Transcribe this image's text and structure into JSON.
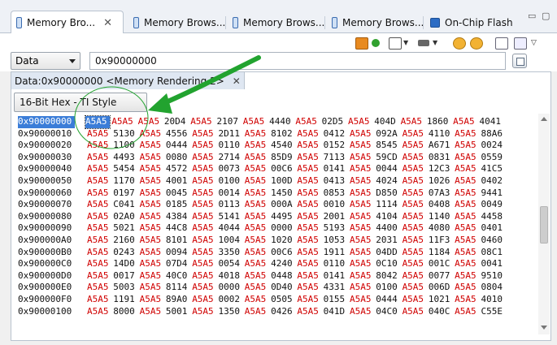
{
  "tabs": [
    {
      "label": "Memory Bro...",
      "active": true
    },
    {
      "label": "Memory Brows...",
      "active": false
    },
    {
      "label": "Memory Brows...",
      "active": false
    },
    {
      "label": "Memory Brows...",
      "active": false
    },
    {
      "label": "On-Chip Flash",
      "active": false
    }
  ],
  "window_controls": {
    "minimize": "▭",
    "maximize": "▢"
  },
  "toolbar_icons": [
    "refresh-icon",
    "import-icon",
    "chip-icon",
    "go-icon",
    "sync-icon",
    "new-view-icon",
    "pin-icon",
    "view-menu-icon"
  ],
  "format_select": {
    "value": "Data"
  },
  "address_input": {
    "value": "0x90000000"
  },
  "rendering_tab": {
    "label": "Data:0x90000000 <Memory Rendering 2>"
  },
  "style_select": {
    "value": "16-Bit Hex - TI Style"
  },
  "colors": {
    "accent": "#3b7dd8",
    "changed_value": "#d00000",
    "annotation": "#22a32f"
  },
  "memory": {
    "changed_value": "A5A5",
    "rows": [
      {
        "address": "0x90000000",
        "values": [
          "A5A5",
          "A5A5",
          "A5A5",
          "20D4",
          "A5A5",
          "2107",
          "A5A5",
          "4440",
          "A5A5",
          "02D5",
          "A5A5",
          "404D",
          "A5A5",
          "1860",
          "A5A5",
          "4041"
        ]
      },
      {
        "address": "0x90000010",
        "values": [
          "A5A5",
          "5130",
          "A5A5",
          "4556",
          "A5A5",
          "2D11",
          "A5A5",
          "8102",
          "A5A5",
          "0412",
          "A5A5",
          "092A",
          "A5A5",
          "4110",
          "A5A5",
          "88A6"
        ]
      },
      {
        "address": "0x90000020",
        "values": [
          "A5A5",
          "1100",
          "A5A5",
          "0444",
          "A5A5",
          "0110",
          "A5A5",
          "4540",
          "A5A5",
          "0152",
          "A5A5",
          "8545",
          "A5A5",
          "A671",
          "A5A5",
          "0024"
        ]
      },
      {
        "address": "0x90000030",
        "values": [
          "A5A5",
          "4493",
          "A5A5",
          "0080",
          "A5A5",
          "2714",
          "A5A5",
          "85D9",
          "A5A5",
          "7113",
          "A5A5",
          "59CD",
          "A5A5",
          "0831",
          "A5A5",
          "0559"
        ]
      },
      {
        "address": "0x90000040",
        "values": [
          "A5A5",
          "5454",
          "A5A5",
          "4572",
          "A5A5",
          "0073",
          "A5A5",
          "00C6",
          "A5A5",
          "0141",
          "A5A5",
          "0044",
          "A5A5",
          "12C3",
          "A5A5",
          "41C5"
        ]
      },
      {
        "address": "0x90000050",
        "values": [
          "A5A5",
          "1170",
          "A5A5",
          "4001",
          "A5A5",
          "0100",
          "A5A5",
          "100D",
          "A5A5",
          "0413",
          "A5A5",
          "4024",
          "A5A5",
          "1026",
          "A5A5",
          "0402"
        ]
      },
      {
        "address": "0x90000060",
        "values": [
          "A5A5",
          "0197",
          "A5A5",
          "0045",
          "A5A5",
          "0014",
          "A5A5",
          "1450",
          "A5A5",
          "0853",
          "A5A5",
          "D850",
          "A5A5",
          "07A3",
          "A5A5",
          "9441"
        ]
      },
      {
        "address": "0x90000070",
        "values": [
          "A5A5",
          "C041",
          "A5A5",
          "0185",
          "A5A5",
          "0113",
          "A5A5",
          "000A",
          "A5A5",
          "0010",
          "A5A5",
          "1114",
          "A5A5",
          "0408",
          "A5A5",
          "0049"
        ]
      },
      {
        "address": "0x90000080",
        "values": [
          "A5A5",
          "02A0",
          "A5A5",
          "4384",
          "A5A5",
          "5141",
          "A5A5",
          "4495",
          "A5A5",
          "2001",
          "A5A5",
          "4104",
          "A5A5",
          "1140",
          "A5A5",
          "4458"
        ]
      },
      {
        "address": "0x90000090",
        "values": [
          "A5A5",
          "5021",
          "A5A5",
          "44C8",
          "A5A5",
          "4044",
          "A5A5",
          "0000",
          "A5A5",
          "5193",
          "A5A5",
          "4400",
          "A5A5",
          "4080",
          "A5A5",
          "0401"
        ]
      },
      {
        "address": "0x900000A0",
        "values": [
          "A5A5",
          "2160",
          "A5A5",
          "8101",
          "A5A5",
          "1004",
          "A5A5",
          "1020",
          "A5A5",
          "1053",
          "A5A5",
          "2031",
          "A5A5",
          "11F3",
          "A5A5",
          "0460"
        ]
      },
      {
        "address": "0x900000B0",
        "values": [
          "A5A5",
          "0243",
          "A5A5",
          "0094",
          "A5A5",
          "3350",
          "A5A5",
          "00C6",
          "A5A5",
          "1911",
          "A5A5",
          "04DD",
          "A5A5",
          "1184",
          "A5A5",
          "08C1"
        ]
      },
      {
        "address": "0x900000C0",
        "values": [
          "A5A5",
          "14D0",
          "A5A5",
          "07D4",
          "A5A5",
          "0054",
          "A5A5",
          "4240",
          "A5A5",
          "0110",
          "A5A5",
          "0C10",
          "A5A5",
          "001C",
          "A5A5",
          "0041"
        ]
      },
      {
        "address": "0x900000D0",
        "values": [
          "A5A5",
          "0017",
          "A5A5",
          "40C0",
          "A5A5",
          "4018",
          "A5A5",
          "0448",
          "A5A5",
          "0141",
          "A5A5",
          "8042",
          "A5A5",
          "0077",
          "A5A5",
          "9510"
        ]
      },
      {
        "address": "0x900000E0",
        "values": [
          "A5A5",
          "5003",
          "A5A5",
          "8114",
          "A5A5",
          "0000",
          "A5A5",
          "0D40",
          "A5A5",
          "4331",
          "A5A5",
          "0100",
          "A5A5",
          "006D",
          "A5A5",
          "0804"
        ]
      },
      {
        "address": "0x900000F0",
        "values": [
          "A5A5",
          "1191",
          "A5A5",
          "89A0",
          "A5A5",
          "0002",
          "A5A5",
          "0505",
          "A5A5",
          "0155",
          "A5A5",
          "0444",
          "A5A5",
          "1021",
          "A5A5",
          "4010"
        ]
      },
      {
        "address": "0x90000100",
        "values": [
          "A5A5",
          "8000",
          "A5A5",
          "5001",
          "A5A5",
          "1350",
          "A5A5",
          "0426",
          "A5A5",
          "041D",
          "A5A5",
          "04C0",
          "A5A5",
          "040C",
          "A5A5",
          "C55E"
        ]
      }
    ]
  }
}
